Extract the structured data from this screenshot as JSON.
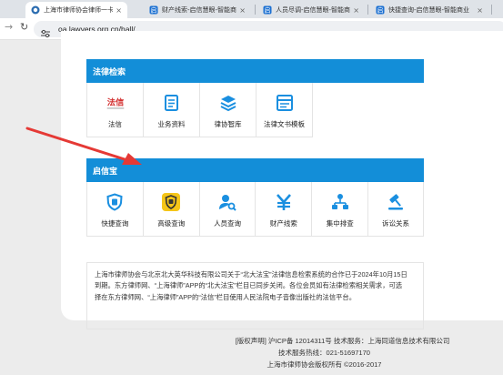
{
  "browser": {
    "tabs": [
      {
        "title": "上海市律师协会律师一卡通服务",
        "active": true
      },
      {
        "title": "财产线索-启信慧眼-智能商业",
        "active": false
      },
      {
        "title": "人员尽调-启信慧眼-智能商业",
        "active": false
      },
      {
        "title": "快捷查询-启信慧眼-智能商业",
        "active": false
      }
    ],
    "url": "oa.lawyers.org.cn/hall/"
  },
  "sections": [
    {
      "title": "法律检索",
      "items": [
        {
          "label": "法信",
          "icon": "faxin-logo-icon",
          "logo_text": "法信"
        },
        {
          "label": "业务资料",
          "icon": "document-icon"
        },
        {
          "label": "律协智库",
          "icon": "layers-icon"
        },
        {
          "label": "法律文书模板",
          "icon": "template-icon"
        }
      ]
    },
    {
      "title": "启信宝",
      "items": [
        {
          "label": "快捷查询",
          "icon": "shield-icon"
        },
        {
          "label": "高级查询",
          "icon": "yellow-shield-icon"
        },
        {
          "label": "人员查询",
          "icon": "person-search-icon"
        },
        {
          "label": "财产线索",
          "icon": "yen-icon"
        },
        {
          "label": "集中排查",
          "icon": "hierarchy-icon"
        },
        {
          "label": "诉讼关系",
          "icon": "gavel-icon"
        }
      ]
    }
  ],
  "notice": {
    "lines": [
      "上海市律师协会与北京北大英华科技有限公司关于“北大法宝”法律信息检索系统的合作已于2024年10月15日",
      "到期。东方律师网、“上海律师”APP的“北大法宝”栏目已同步关闭。各位会员如有法律检索相关需求，可选",
      "择在东方律师网、“上海律师”APP的“法信”栏目使用人民法院电子音像出版社的法信平台。"
    ]
  },
  "footer": {
    "line1": "[版权声明] 沪ICP备 12014311号 技术服务：上海同道信息技术有限公司",
    "line2": "技术服务热线：021-51697170",
    "line3": "上海市律师协会版权所有 ©2016-2017"
  },
  "colors": {
    "section_header": "#138ed8",
    "icon_blue": "#1a8fe0",
    "annotation_arrow": "#e53935",
    "yellow_icon": "#f5c518"
  }
}
